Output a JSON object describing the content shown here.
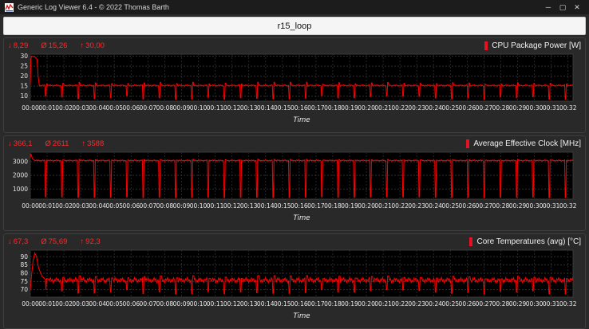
{
  "window": {
    "title": "Generic Log Viewer 6.4 - © 2022 Thomas Barth",
    "minimize_glyph": "─",
    "maximize_glyph": "▢",
    "close_glyph": "✕"
  },
  "header": {
    "title": "r15_loop"
  },
  "colors": {
    "line": "#ff0000",
    "stat_text": "#ff2a2a",
    "accent_bar": "#e81123"
  },
  "chart_data": [
    {
      "type": "line",
      "title": "CPU Package Power [W]",
      "stats": [
        {
          "glyph": "↓",
          "value": "8,29"
        },
        {
          "glyph": "Ø",
          "value": "15,26"
        },
        {
          "glyph": "↑",
          "value": "30,00"
        }
      ],
      "xlabel": "Time",
      "x_ticks": [
        "00:00",
        "00:01",
        "00:02",
        "00:03",
        "00:04",
        "00:05",
        "00:06",
        "00:07",
        "00:08",
        "00:09",
        "00:10",
        "00:11",
        "00:12",
        "00:13",
        "00:14",
        "00:15",
        "00:16",
        "00:17",
        "00:18",
        "00:19",
        "00:20",
        "00:21",
        "00:22",
        "00:23",
        "00:24",
        "00:25",
        "00:26",
        "00:27",
        "00:28",
        "00:29",
        "00:30",
        "00:31",
        "00:32"
      ],
      "x_tick_interval_s": 60,
      "duration_s": 1938,
      "y_ticks": [
        10,
        15,
        20,
        25,
        30
      ],
      "ylim": [
        7.5,
        31
      ],
      "line_color": "#ff0000",
      "series_spec": {
        "period_s": 58,
        "baseline": 15.35,
        "noise": [
          0.22,
          0.15
        ],
        "spike_val": 16.5,
        "spike_var": 0.5,
        "spike_len_s": 4,
        "dip_val": 10.2,
        "dip_var": 1.9,
        "dip_len_s": 5,
        "init_end_s": 32,
        "init_points": [
          [
            0,
            16
          ],
          [
            2,
            28
          ],
          [
            4,
            30
          ],
          [
            18,
            29.5
          ],
          [
            24,
            28.5
          ],
          [
            28,
            20
          ],
          [
            32,
            15.6
          ]
        ]
      }
    },
    {
      "type": "line",
      "title": "Average Effective Clock [MHz]",
      "stats": [
        {
          "glyph": "↓",
          "value": "366,1"
        },
        {
          "glyph": "Ø",
          "value": "2611"
        },
        {
          "glyph": "↑",
          "value": "3588"
        }
      ],
      "xlabel": "Time",
      "x_ticks": [
        "00:00",
        "00:01",
        "00:02",
        "00:03",
        "00:04",
        "00:05",
        "00:06",
        "00:07",
        "00:08",
        "00:09",
        "00:10",
        "00:11",
        "00:12",
        "00:13",
        "00:14",
        "00:15",
        "00:16",
        "00:17",
        "00:18",
        "00:19",
        "00:20",
        "00:21",
        "00:22",
        "00:23",
        "00:24",
        "00:25",
        "00:26",
        "00:27",
        "00:28",
        "00:29",
        "00:30",
        "00:31",
        "00:32"
      ],
      "x_tick_interval_s": 60,
      "duration_s": 1938,
      "y_ticks": [
        1000,
        2000,
        3000
      ],
      "ylim": [
        260,
        3700
      ],
      "line_color": "#ff0000",
      "series_spec": {
        "period_s": 58,
        "baseline": 3090,
        "noise": [
          28,
          18
        ],
        "spike_val": 3140,
        "spike_var": 40,
        "spike_len_s": 4,
        "dip_val": 430,
        "dip_var": 64,
        "dip_len_s": 5,
        "init_end_s": 14,
        "init_points": [
          [
            0,
            3300
          ],
          [
            2,
            3588
          ],
          [
            8,
            3200
          ],
          [
            14,
            3120
          ]
        ]
      }
    },
    {
      "type": "line",
      "title": "Core Temperatures (avg) [°C]",
      "stats": [
        {
          "glyph": "↓",
          "value": "67,3"
        },
        {
          "glyph": "Ø",
          "value": "75,69"
        },
        {
          "glyph": "↑",
          "value": "92,3"
        }
      ],
      "xlabel": "Time",
      "x_ticks": [
        "00:00",
        "00:01",
        "00:02",
        "00:03",
        "00:04",
        "00:05",
        "00:06",
        "00:07",
        "00:08",
        "00:09",
        "00:10",
        "00:11",
        "00:12",
        "00:13",
        "00:14",
        "00:15",
        "00:16",
        "00:17",
        "00:18",
        "00:19",
        "00:20",
        "00:21",
        "00:22",
        "00:23",
        "00:24",
        "00:25",
        "00:26",
        "00:27",
        "00:28",
        "00:29",
        "00:30",
        "00:31",
        "00:32"
      ],
      "x_tick_interval_s": 60,
      "duration_s": 1938,
      "y_ticks": [
        70,
        75,
        80,
        85,
        90
      ],
      "ylim": [
        65.5,
        94
      ],
      "line_color": "#ff0000",
      "series_spec": {
        "period_s": 58,
        "baseline": 75.8,
        "noise": [
          0.9,
          0.7
        ],
        "spike_val": 77.6,
        "spike_var": 1.0,
        "spike_len_s": 5,
        "dip_val": 70.0,
        "dip_var": 2.7,
        "dip_len_s": 5,
        "init_end_s": 55,
        "init_points": [
          [
            0,
            70
          ],
          [
            4,
            78
          ],
          [
            10,
            88
          ],
          [
            16,
            92.3
          ],
          [
            22,
            90
          ],
          [
            30,
            83
          ],
          [
            42,
            78
          ],
          [
            55,
            76.2
          ]
        ]
      }
    }
  ]
}
